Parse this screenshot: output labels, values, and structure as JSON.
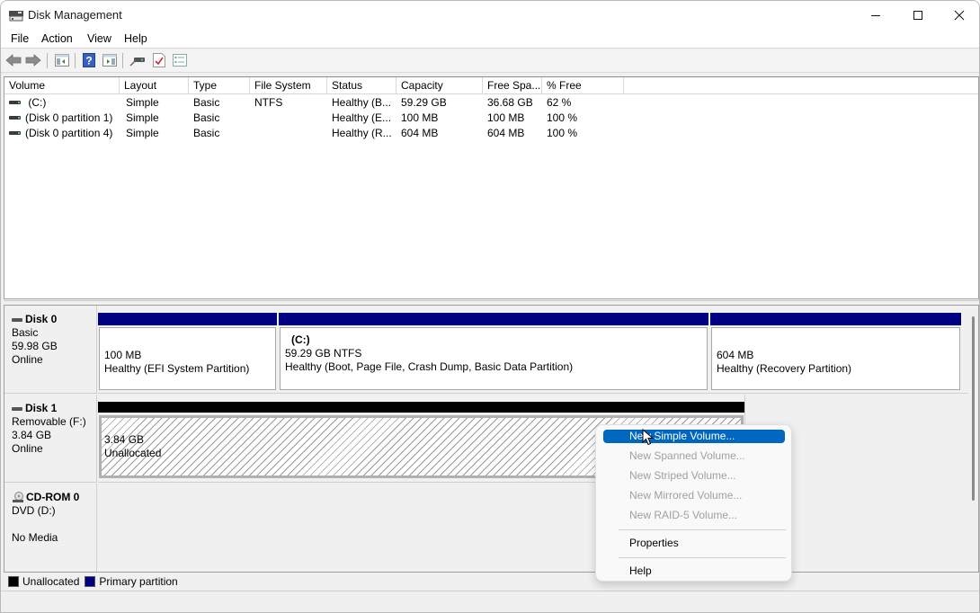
{
  "window": {
    "title": "Disk Management",
    "controls": {
      "minimize": "minimize",
      "maximize": "maximize",
      "close": "close"
    }
  },
  "menubar": [
    "File",
    "Action",
    "View",
    "Help"
  ],
  "toolbar": {
    "buttons": [
      "back-arrow",
      "forward-arrow",
      "console-tree",
      "help",
      "action-pane",
      "connect-drive",
      "checklist-properties",
      "settings-list"
    ]
  },
  "volume_list": {
    "columns": [
      "Volume",
      "Layout",
      "Type",
      "File System",
      "Status",
      "Capacity",
      "Free Spa...",
      "% Free"
    ],
    "rows": [
      {
        "volume": " (C:)",
        "layout": "Simple",
        "type": "Basic",
        "fs": "NTFS",
        "status": "Healthy (B...",
        "capacity": "59.29 GB",
        "free": "36.68 GB",
        "pct": "62 %"
      },
      {
        "volume": "(Disk 0 partition 1)",
        "layout": "Simple",
        "type": "Basic",
        "fs": "",
        "status": "Healthy (E...",
        "capacity": "100 MB",
        "free": "100 MB",
        "pct": "100 %"
      },
      {
        "volume": "(Disk 0 partition 4)",
        "layout": "Simple",
        "type": "Basic",
        "fs": "",
        "status": "Healthy (R...",
        "capacity": "604 MB",
        "free": "604 MB",
        "pct": "100 %"
      }
    ]
  },
  "disks": [
    {
      "name": "Disk 0",
      "type": "Basic",
      "size": "59.98 GB",
      "state": "Online",
      "partitions": [
        {
          "title": "",
          "size": "100 MB",
          "status": "Healthy (EFI System Partition)"
        },
        {
          "title": "(C:)",
          "size": "59.29 GB NTFS",
          "status": "Healthy (Boot, Page File, Crash Dump, Basic Data Partition)"
        },
        {
          "title": "",
          "size": "604 MB",
          "status": "Healthy (Recovery Partition)"
        }
      ]
    },
    {
      "name": "Disk 1",
      "type": "Removable (F:)",
      "size": "3.84 GB",
      "state": "Online",
      "partitions": [
        {
          "size": "3.84 GB",
          "status": "Unallocated"
        }
      ]
    },
    {
      "name": "CD-ROM 0",
      "type": "DVD (D:)",
      "size": "",
      "state": "No Media"
    }
  ],
  "legend": [
    {
      "label": "Unallocated",
      "color": "#000000"
    },
    {
      "label": "Primary partition",
      "color": "#000080"
    }
  ],
  "context_menu": {
    "items": [
      {
        "label": "New Simple Volume...",
        "state": "highlighted"
      },
      {
        "label": "New Spanned Volume...",
        "state": "disabled"
      },
      {
        "label": "New Striped Volume...",
        "state": "disabled"
      },
      {
        "label": "New Mirrored Volume...",
        "state": "disabled"
      },
      {
        "label": "New RAID-5 Volume...",
        "state": "disabled"
      },
      {
        "label": "Properties",
        "state": "enabled"
      },
      {
        "label": "Help",
        "state": "enabled"
      }
    ]
  },
  "colors": {
    "primary_partition": "#000080",
    "unallocated": "#000000",
    "menu_highlight": "#0067c0"
  }
}
